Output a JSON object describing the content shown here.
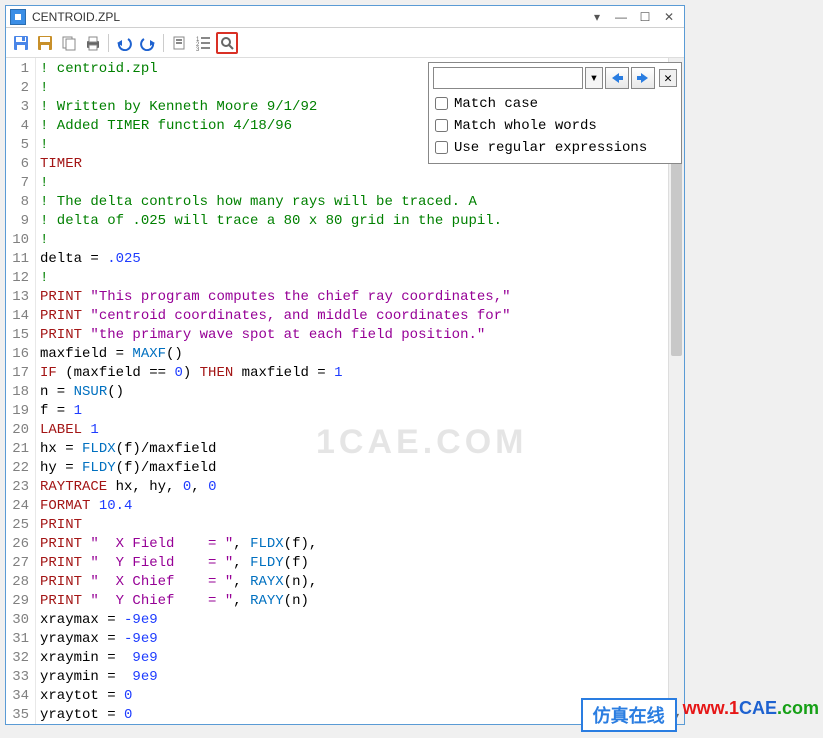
{
  "titlebar": {
    "title": "CENTROID.ZPL"
  },
  "toolbar": {
    "save": "save",
    "saveas": "saveas",
    "copy": "copy",
    "print": "print",
    "undo": "undo",
    "redo": "redo",
    "bookmarks": "bookmarks",
    "numbered": "numbered",
    "search": "search"
  },
  "search": {
    "placeholder": "",
    "match_case": "Match case",
    "match_whole": "Match whole words",
    "use_regex": "Use regular expressions"
  },
  "code": {
    "lines": [
      {
        "n": "1",
        "seg": [
          [
            "c-comment",
            "! centroid.zpl"
          ]
        ]
      },
      {
        "n": "2",
        "seg": [
          [
            "c-comment",
            "!"
          ]
        ]
      },
      {
        "n": "3",
        "seg": [
          [
            "c-comment",
            "! Written by Kenneth Moore 9/1/92"
          ]
        ]
      },
      {
        "n": "4",
        "seg": [
          [
            "c-comment",
            "! Added TIMER function 4/18/96"
          ]
        ]
      },
      {
        "n": "5",
        "seg": [
          [
            "c-comment",
            "!"
          ]
        ]
      },
      {
        "n": "6",
        "seg": [
          [
            "c-kw",
            "TIMER"
          ]
        ]
      },
      {
        "n": "7",
        "seg": [
          [
            "c-comment",
            "!"
          ]
        ]
      },
      {
        "n": "8",
        "seg": [
          [
            "c-comment",
            "! The delta controls how many rays will be traced. A"
          ]
        ]
      },
      {
        "n": "9",
        "seg": [
          [
            "c-comment",
            "! delta of .025 will trace a 80 x 80 grid in the pupil."
          ]
        ]
      },
      {
        "n": "10",
        "seg": [
          [
            "c-comment",
            "!"
          ]
        ]
      },
      {
        "n": "11",
        "seg": [
          [
            "",
            "delta = "
          ],
          [
            "c-num",
            ".025"
          ]
        ]
      },
      {
        "n": "12",
        "seg": [
          [
            "c-comment",
            "!"
          ]
        ]
      },
      {
        "n": "13",
        "seg": [
          [
            "c-kw",
            "PRINT"
          ],
          [
            "",
            " "
          ],
          [
            "c-str",
            "\"This program computes the chief ray coordinates,\""
          ]
        ]
      },
      {
        "n": "14",
        "seg": [
          [
            "c-kw",
            "PRINT"
          ],
          [
            "",
            " "
          ],
          [
            "c-str",
            "\"centroid coordinates, and middle coordinates for\""
          ]
        ]
      },
      {
        "n": "15",
        "seg": [
          [
            "c-kw",
            "PRINT"
          ],
          [
            "",
            " "
          ],
          [
            "c-str",
            "\"the primary wave spot at each field position.\""
          ]
        ]
      },
      {
        "n": "16",
        "seg": [
          [
            "",
            "maxfield = "
          ],
          [
            "c-func",
            "MAXF"
          ],
          [
            "",
            "()"
          ]
        ]
      },
      {
        "n": "17",
        "seg": [
          [
            "c-kw",
            "IF"
          ],
          [
            "",
            " (maxfield == "
          ],
          [
            "c-num",
            "0"
          ],
          [
            "",
            ") "
          ],
          [
            "c-kw",
            "THEN"
          ],
          [
            "",
            " maxfield = "
          ],
          [
            "c-num",
            "1"
          ]
        ]
      },
      {
        "n": "18",
        "seg": [
          [
            "",
            "n = "
          ],
          [
            "c-func",
            "NSUR"
          ],
          [
            "",
            "()"
          ]
        ]
      },
      {
        "n": "19",
        "seg": [
          [
            "",
            "f = "
          ],
          [
            "c-num",
            "1"
          ]
        ]
      },
      {
        "n": "20",
        "seg": [
          [
            "c-kw",
            "LABEL"
          ],
          [
            "",
            " "
          ],
          [
            "c-num",
            "1"
          ]
        ]
      },
      {
        "n": "21",
        "seg": [
          [
            "",
            "hx = "
          ],
          [
            "c-func",
            "FLDX"
          ],
          [
            "",
            "(f)/maxfield"
          ]
        ]
      },
      {
        "n": "22",
        "seg": [
          [
            "",
            "hy = "
          ],
          [
            "c-func",
            "FLDY"
          ],
          [
            "",
            "(f)/maxfield"
          ]
        ]
      },
      {
        "n": "23",
        "seg": [
          [
            "c-kw",
            "RAYTRACE"
          ],
          [
            "",
            " hx, hy, "
          ],
          [
            "c-num",
            "0"
          ],
          [
            "",
            ", "
          ],
          [
            "c-num",
            "0"
          ]
        ]
      },
      {
        "n": "24",
        "seg": [
          [
            "c-kw",
            "FORMAT"
          ],
          [
            "",
            " "
          ],
          [
            "c-num",
            "10.4"
          ]
        ]
      },
      {
        "n": "25",
        "seg": [
          [
            "c-kw",
            "PRINT"
          ]
        ]
      },
      {
        "n": "26",
        "seg": [
          [
            "c-kw",
            "PRINT"
          ],
          [
            "",
            " "
          ],
          [
            "c-str",
            "\"  X Field    = \""
          ],
          [
            "",
            ", "
          ],
          [
            "c-func",
            "FLDX"
          ],
          [
            "",
            "(f),"
          ]
        ]
      },
      {
        "n": "27",
        "seg": [
          [
            "c-kw",
            "PRINT"
          ],
          [
            "",
            " "
          ],
          [
            "c-str",
            "\"  Y Field    = \""
          ],
          [
            "",
            ", "
          ],
          [
            "c-func",
            "FLDY"
          ],
          [
            "",
            "(f)"
          ]
        ]
      },
      {
        "n": "28",
        "seg": [
          [
            "c-kw",
            "PRINT"
          ],
          [
            "",
            " "
          ],
          [
            "c-str",
            "\"  X Chief    = \""
          ],
          [
            "",
            ", "
          ],
          [
            "c-func",
            "RAYX"
          ],
          [
            "",
            "(n),"
          ]
        ]
      },
      {
        "n": "29",
        "seg": [
          [
            "c-kw",
            "PRINT"
          ],
          [
            "",
            " "
          ],
          [
            "c-str",
            "\"  Y Chief    = \""
          ],
          [
            "",
            ", "
          ],
          [
            "c-func",
            "RAYY"
          ],
          [
            "",
            "(n)"
          ]
        ]
      },
      {
        "n": "30",
        "seg": [
          [
            "",
            "xraymax = "
          ],
          [
            "c-num",
            "-9e9"
          ]
        ]
      },
      {
        "n": "31",
        "seg": [
          [
            "",
            "yraymax = "
          ],
          [
            "c-num",
            "-9e9"
          ]
        ]
      },
      {
        "n": "32",
        "seg": [
          [
            "",
            "xraymin =  "
          ],
          [
            "c-num",
            "9e9"
          ]
        ]
      },
      {
        "n": "33",
        "seg": [
          [
            "",
            "yraymin =  "
          ],
          [
            "c-num",
            "9e9"
          ]
        ]
      },
      {
        "n": "34",
        "seg": [
          [
            "",
            "xraytot = "
          ],
          [
            "c-num",
            "0"
          ]
        ]
      },
      {
        "n": "35",
        "seg": [
          [
            "",
            "yraytot = "
          ],
          [
            "c-num",
            "0"
          ]
        ]
      }
    ]
  },
  "watermark": "1CAE.COM",
  "footer": {
    "cn": "仿真在线",
    "url_1": "www.1",
    "url_cae": "CAE",
    "url_com": ".com"
  }
}
